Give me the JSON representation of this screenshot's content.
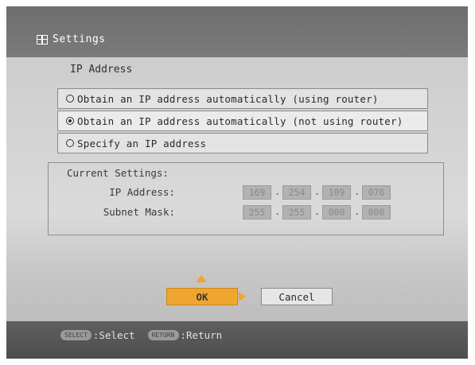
{
  "header": {
    "title": "Settings",
    "icon": "settings-grid-icon"
  },
  "section": {
    "title": "IP Address"
  },
  "options": [
    {
      "label": "Obtain an IP address automatically (using router)",
      "selected": false
    },
    {
      "label": "Obtain an IP address automatically (not using router)",
      "selected": true
    },
    {
      "label": "Specify an IP address",
      "selected": false
    }
  ],
  "current": {
    "title": "Current Settings:",
    "ip_label": "IP Address:",
    "ip": [
      "169",
      "254",
      "109",
      "076"
    ],
    "mask_label": "Subnet Mask:",
    "mask": [
      "255",
      "255",
      "000",
      "000"
    ]
  },
  "buttons": {
    "ok": "OK",
    "cancel": "Cancel"
  },
  "footer": {
    "select_key": "SELECT",
    "select_label": ":Select",
    "return_key": "RETURN",
    "return_label": ":Return"
  },
  "colors": {
    "accent": "#f0a62e"
  }
}
